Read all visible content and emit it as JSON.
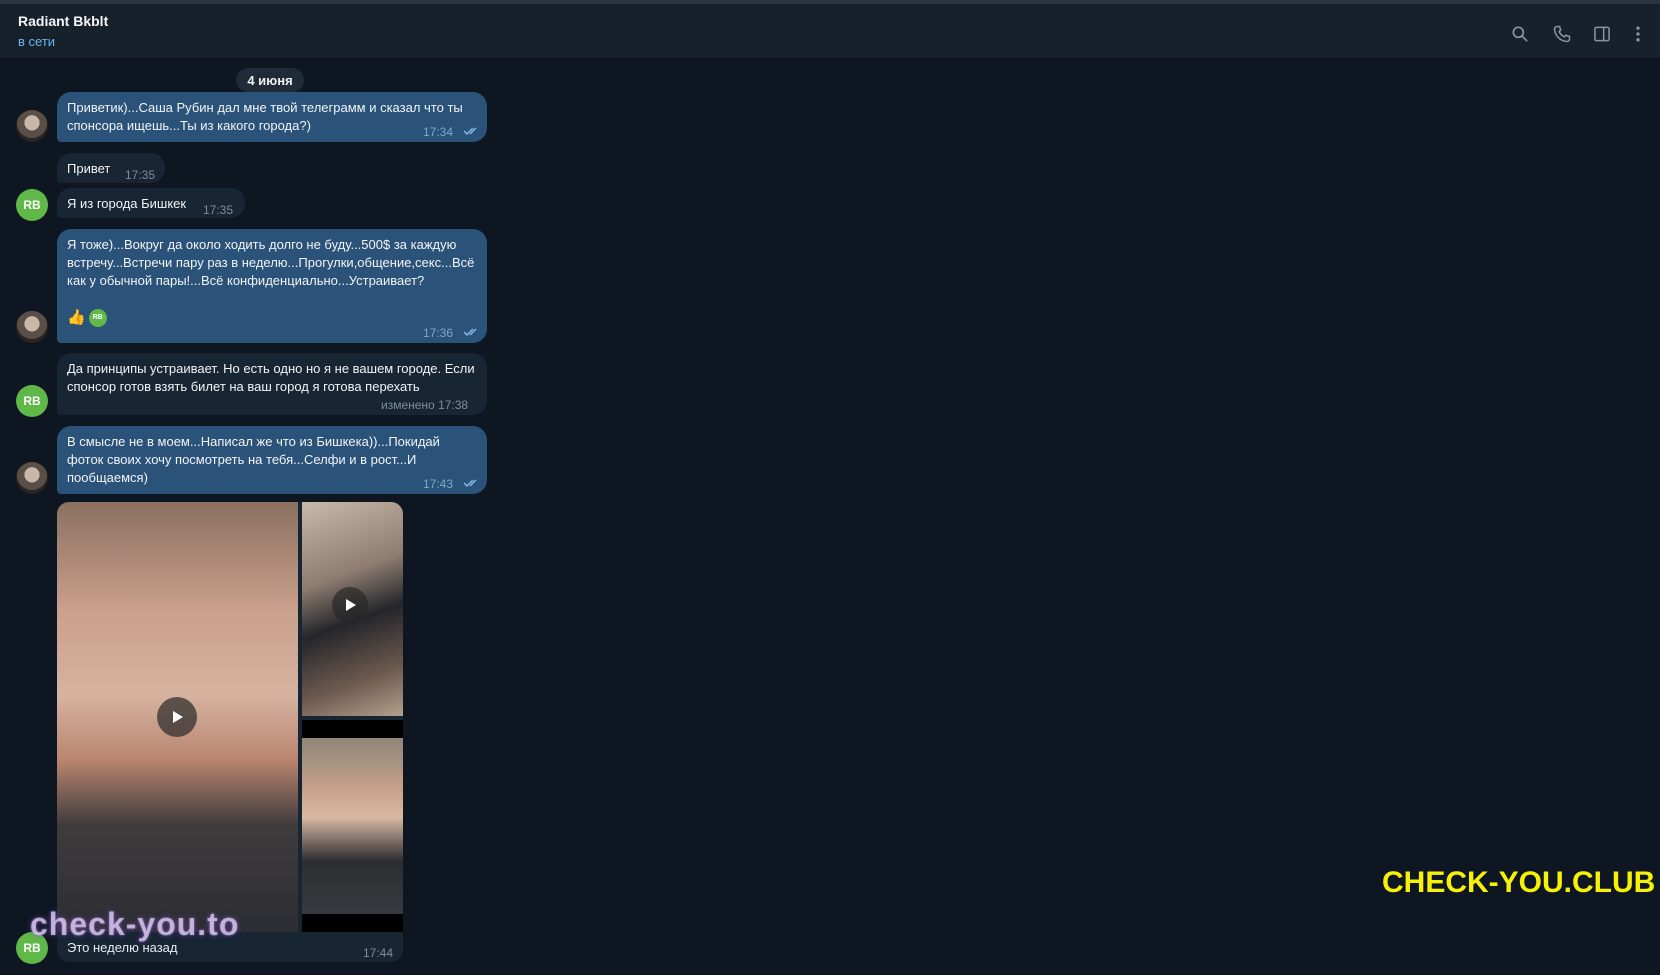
{
  "header": {
    "chat_name": "Radiant Bkblt",
    "status": "в сети",
    "icons": [
      "search-icon",
      "phone-icon",
      "sidebar-toggle-icon",
      "more-vertical-icon"
    ]
  },
  "date_separator": "4 июня",
  "messages": [
    {
      "direction": "out",
      "text": "Приветик)...Саша Рубин дал мне твой телеграмм и сказал что ты спонсора ищешь...Ты из какого города?)",
      "time": "17:34",
      "read": true
    },
    {
      "direction": "in",
      "text": "Привет",
      "time": "17:35"
    },
    {
      "direction": "in",
      "text": "Я из города Бишкек",
      "time": "17:35"
    },
    {
      "direction": "out",
      "text": "Я тоже)...Вокруг да около ходить долго не буду...500$ за каждую встречу...Встречи пару раз в неделю...Прогулки,общение,секс...Всё как у обычной пары!...Всё конфиденциально...Устраивает?",
      "time": "17:36",
      "read": true,
      "reactions": {
        "emoji": "👍",
        "badge": "RB"
      }
    },
    {
      "direction": "in",
      "text": "Да принципы устраивает. Но есть одно но я не вашем городе. Если спонсор готов взять билет на ваш город  я готова перехать",
      "time": "изменено 17:38"
    },
    {
      "direction": "out",
      "text": "В смысле не в моем...Написал же что из Бишкека))...Покидай фоток своих хочу посмотреть на тебя...Селфи и в рост...И пообщаемся)",
      "time": "17:43",
      "read": true
    },
    {
      "direction": "in",
      "type": "album",
      "caption": "Это неделю назад",
      "time": "17:44"
    }
  ],
  "avatars": {
    "contact_initials": "RB",
    "contact_color": "#5fb847"
  },
  "watermarks": {
    "left": "check-you.to",
    "right": "CHECK-YOU.CLUB"
  },
  "colors": {
    "background": "#0e1621",
    "header": "#17212b",
    "outgoing": "#2b5278",
    "incoming": "#182533",
    "accent": "#6ab3f3",
    "watermark_right": "#f7f108"
  }
}
